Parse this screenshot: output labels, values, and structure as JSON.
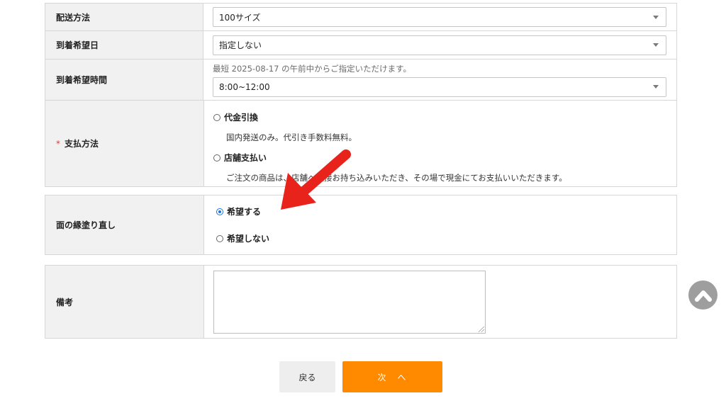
{
  "shipping": {
    "method": {
      "label": "配送方法",
      "value": "100サイズ"
    },
    "date": {
      "label": "到着希望日",
      "value": "指定しない"
    },
    "time": {
      "label": "到着希望時間",
      "note": "最短 2025-08-17 の午前中からご指定いただけます。",
      "value": "8:00~12:00"
    }
  },
  "payment": {
    "required_mark": "*",
    "label": "支払方法",
    "options": [
      {
        "label": "代金引換",
        "description": "国内発送のみ。代引き手数料無料。",
        "checked": false
      },
      {
        "label": "店舗支払い",
        "description": "ご注文の商品は、店舗へ直接お持ち込みいただき、その場で現金にてお支払いいただきます。",
        "checked": false
      }
    ]
  },
  "edge_repaint": {
    "label": "面の縁塗り直し",
    "options": [
      {
        "label": "希望する",
        "checked": true
      },
      {
        "label": "希望しない",
        "checked": false
      }
    ]
  },
  "remarks": {
    "label": "備考",
    "value": ""
  },
  "buttons": {
    "back": "戻る",
    "next": "次　へ"
  },
  "icons": {
    "scroll_top": "chevron-up-circle-icon",
    "annotation": "red-arrow-icon"
  },
  "colors": {
    "accent": "#ff8a00",
    "annotation": "#e8231c",
    "radio_checked": "#1a73e8"
  }
}
